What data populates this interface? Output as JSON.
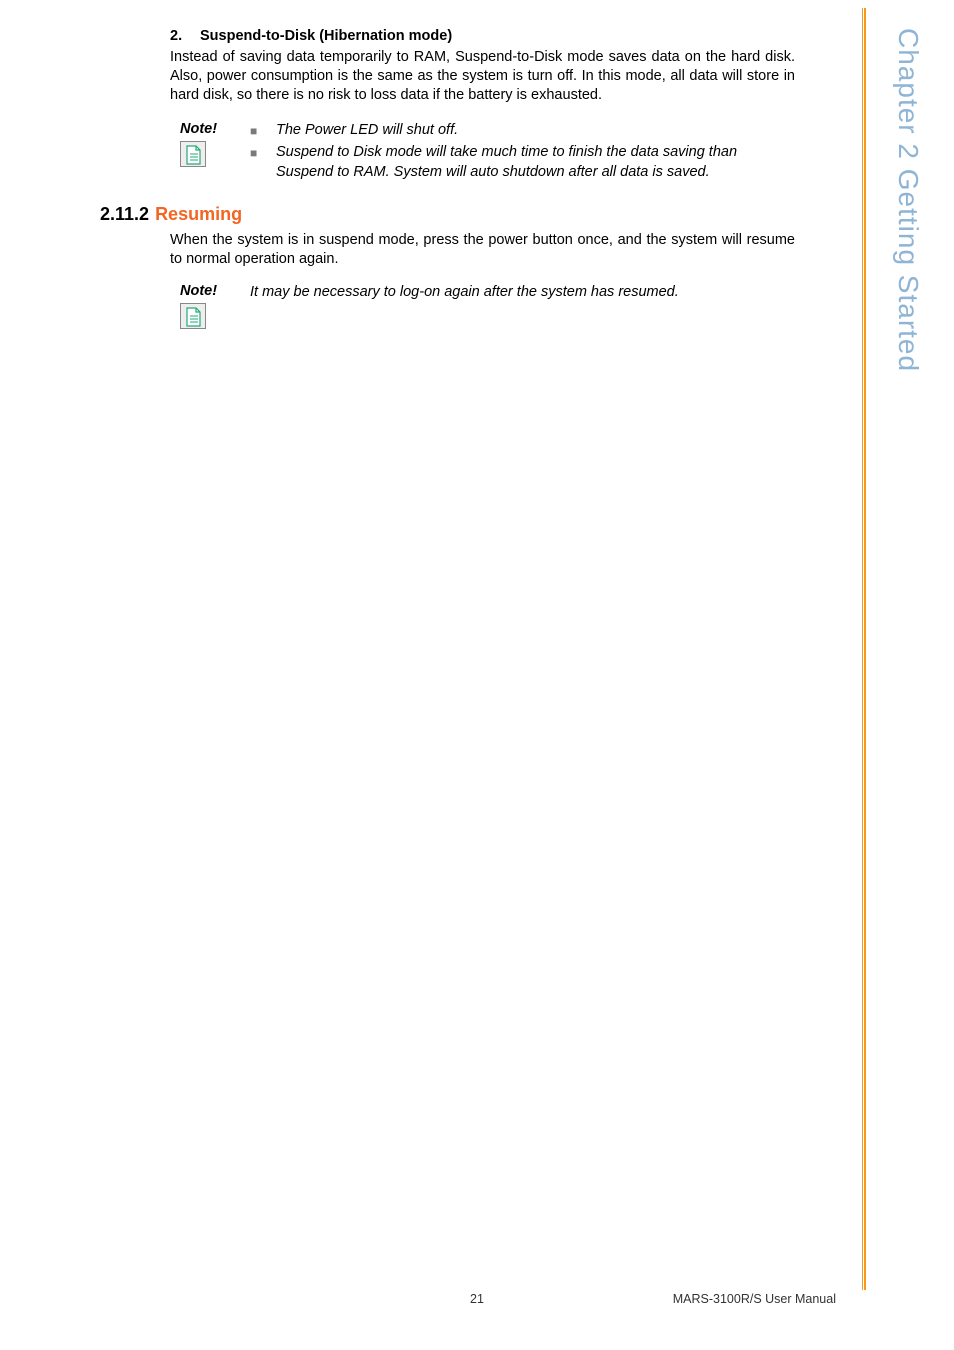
{
  "sideText": "Chapter 2  Getting Started",
  "listItem": {
    "number": "2.",
    "title": "Suspend-to-Disk (Hibernation mode)"
  },
  "paragraph1": "Instead of saving data temporarily to RAM, Suspend-to-Disk mode saves data on the hard disk. Also, power consumption is the same as the system is turn off. In this mode, all data will store in hard disk, so there is no risk to loss data if the battery is exhausted.",
  "note1": {
    "label": "Note!",
    "bullets": [
      "The Power LED will shut off.",
      "Suspend to Disk mode will take much time to finish the data saving than Suspend to RAM. System will auto shutdown after all data is saved."
    ]
  },
  "heading": {
    "number": "2.11.2",
    "title": "Resuming"
  },
  "paragraph2": "When the system is in suspend mode, press the power button once, and the system will resume to normal operation again.",
  "note2": {
    "label": "Note!",
    "text": "It may be necessary to log-on again after the system has resumed."
  },
  "footer": {
    "pageNumber": "21",
    "docName": "MARS-3100R/S User Manual"
  }
}
